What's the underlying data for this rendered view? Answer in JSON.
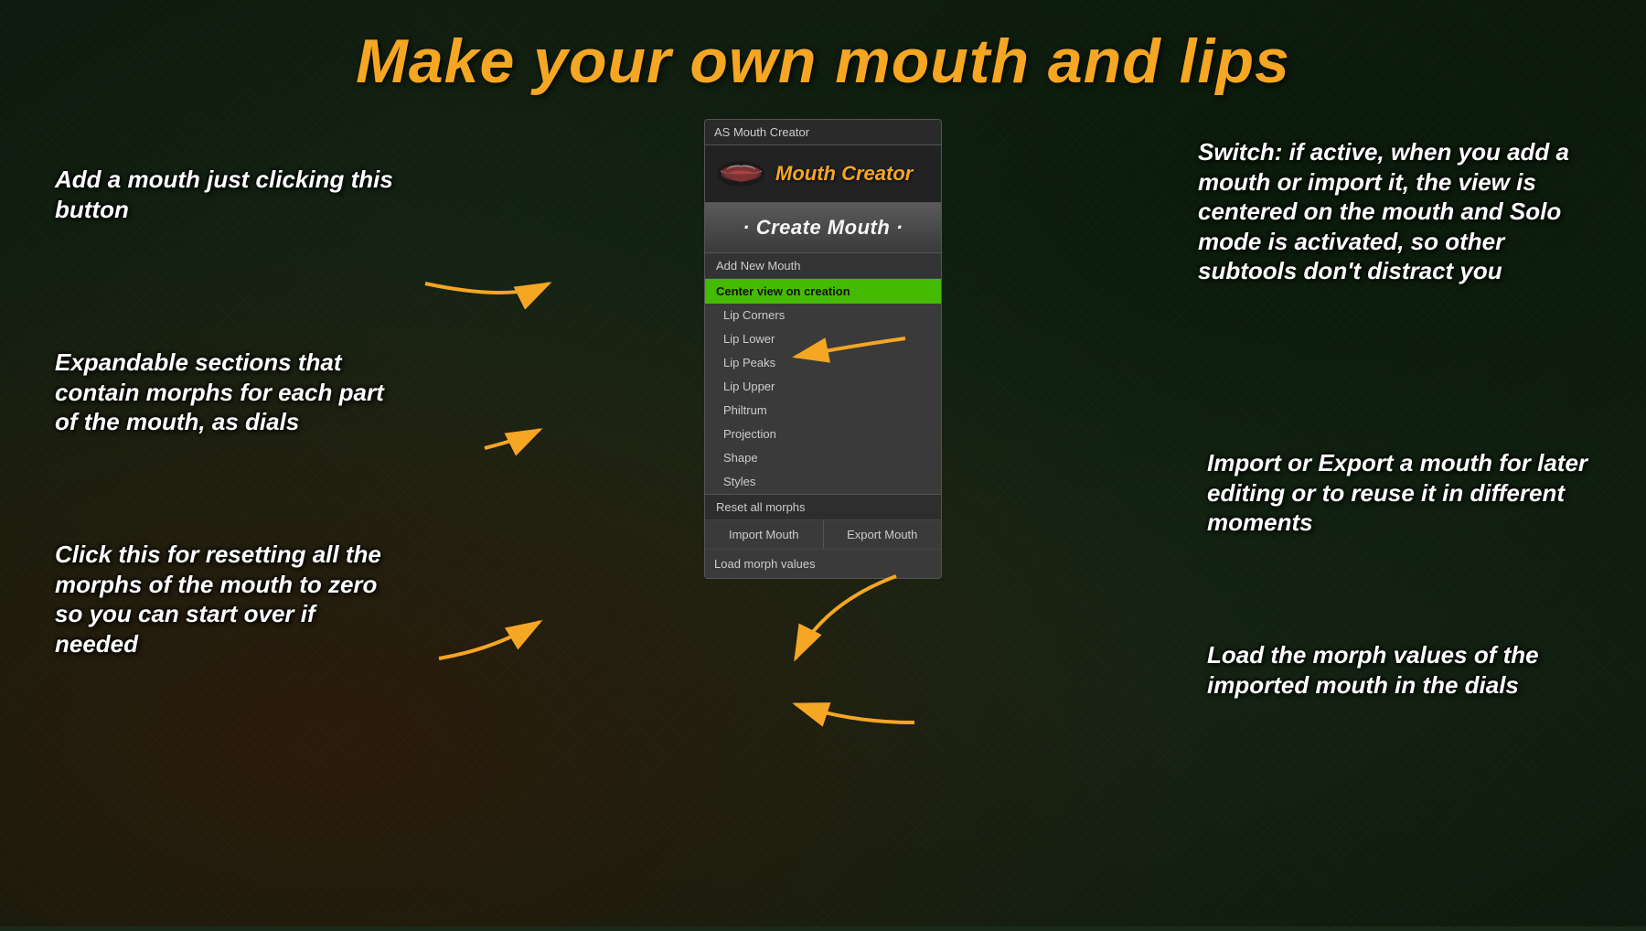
{
  "title": "Make your own mouth and lips",
  "panel": {
    "title_bar": "AS Mouth Creator",
    "logo_text": "Mouth Creator",
    "create_mouth_btn": "· Create Mouth ·",
    "add_new_mouth": "Add New Mouth",
    "center_view": "Center view on creation",
    "menu_items": [
      "Lip Corners",
      "Lip Lower",
      "Lip Peaks",
      "Lip Upper",
      "Philtrum",
      "Projection",
      "Shape",
      "Styles"
    ],
    "reset_all": "Reset all morphs",
    "import_btn": "Import Mouth",
    "export_btn": "Export Mouth",
    "load_morph": "Load morph values"
  },
  "annotations": {
    "top_left": "Add a mouth just clicking\nthis button",
    "mid_left": "Expandable sections\nthat contain morphs\nfor each part of the mouth,\nas dials",
    "bot_left": "Click this for resetting all\nthe morphs of the mouth\nto zero so you can start\nover if needed",
    "top_right": "Switch: if active, when\nyou add a mouth or import\nit, the view is centered\non the mouth and Solo\nmode is activated, so\nother subtools don't\ndistract you",
    "mid_right": "Import or Export a mouth\nfor later editing or to\nreuse it in different\nmoments",
    "bot_right": "Load the morph values\nof the imported mouth\nin the dials"
  },
  "colors": {
    "title": "#f5a623",
    "center_view_bg": "#44bb00",
    "arrow": "#f5a623"
  }
}
